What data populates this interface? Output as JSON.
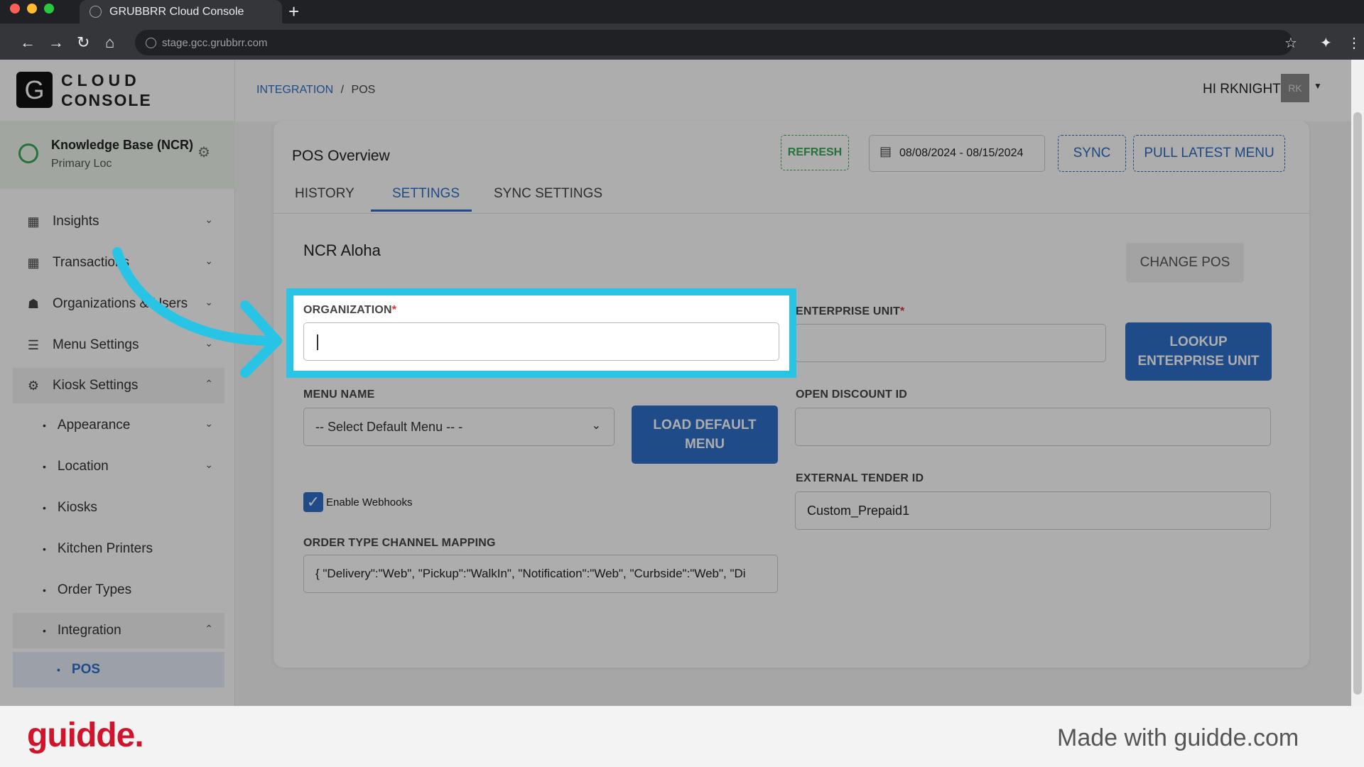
{
  "browser": {
    "tab_title": "GRUBBRR Cloud Console",
    "new_tab": "+",
    "url": "stage.gcc.grubbrr.com"
  },
  "logo": {
    "letter": "G",
    "line1": "CLOUD",
    "line2": "CONSOLE"
  },
  "location": {
    "name": "Knowledge Base (NCR)",
    "sub": "Primary Loc"
  },
  "sidebar": {
    "items": [
      {
        "label": "Insights",
        "icon": "clipboard-chart-icon"
      },
      {
        "label": "Transactions",
        "icon": "clipboard-icon"
      },
      {
        "label": "Organizations & Users",
        "icon": "org-chart-icon"
      },
      {
        "label": "Menu Settings",
        "icon": "menu-list-icon"
      },
      {
        "label": "Kiosk Settings",
        "icon": "gear-icon"
      }
    ],
    "sub_items": [
      "Appearance",
      "Location",
      "Kiosks",
      "Kitchen Printers",
      "Order Types",
      "Integration"
    ],
    "active_sub": "POS"
  },
  "header": {
    "breadcrumb_link": "INTEGRATION",
    "breadcrumb_sep": "/",
    "breadcrumb_current": "POS",
    "greeting": "HI RKNIGHT",
    "avatar": "RK"
  },
  "overview": {
    "title": "POS Overview",
    "refresh": "REFRESH",
    "date_range": "08/08/2024 - 08/15/2024",
    "sync": "SYNC",
    "pull_menu": "PULL LATEST MENU",
    "tabs": [
      "HISTORY",
      "SETTINGS",
      "SYNC SETTINGS"
    ],
    "active_tab": "SETTINGS"
  },
  "settings": {
    "pos_name": "NCR Aloha",
    "change_pos": "CHANGE POS",
    "organization_label": "ORGANIZATION",
    "organization_value": "",
    "enterprise_unit_label": "ENTERPRISE UNIT",
    "enterprise_unit_value": "",
    "lookup_line1": "LOOKUP",
    "lookup_line2": "ENTERPRISE UNIT",
    "menu_name_label": "MENU NAME",
    "menu_name_value": "-- Select Default Menu -- -",
    "load_default_line1": "LOAD DEFAULT",
    "load_default_line2": "MENU",
    "open_discount_label": "OPEN DISCOUNT ID",
    "open_discount_value": "",
    "external_tender_label": "EXTERNAL TENDER ID",
    "external_tender_value": "Custom_Prepaid1",
    "webhooks_label": "Enable Webhooks",
    "webhooks_checked": true,
    "order_mapping_label": "ORDER TYPE CHANNEL MAPPING",
    "order_mapping_value": "{ \"Delivery\":\"Web\", \"Pickup\":\"WalkIn\", \"Notification\":\"Web\", \"Curbside\":\"Web\", \"Di"
  },
  "required_mark": "*",
  "footer": {
    "brand": "guidde.",
    "made_with": "Made with guidde.com"
  },
  "colors": {
    "accent": "#2e70c9",
    "highlight": "#28c4e6",
    "brand": "#d0142c",
    "refresh": "#3aa856"
  }
}
